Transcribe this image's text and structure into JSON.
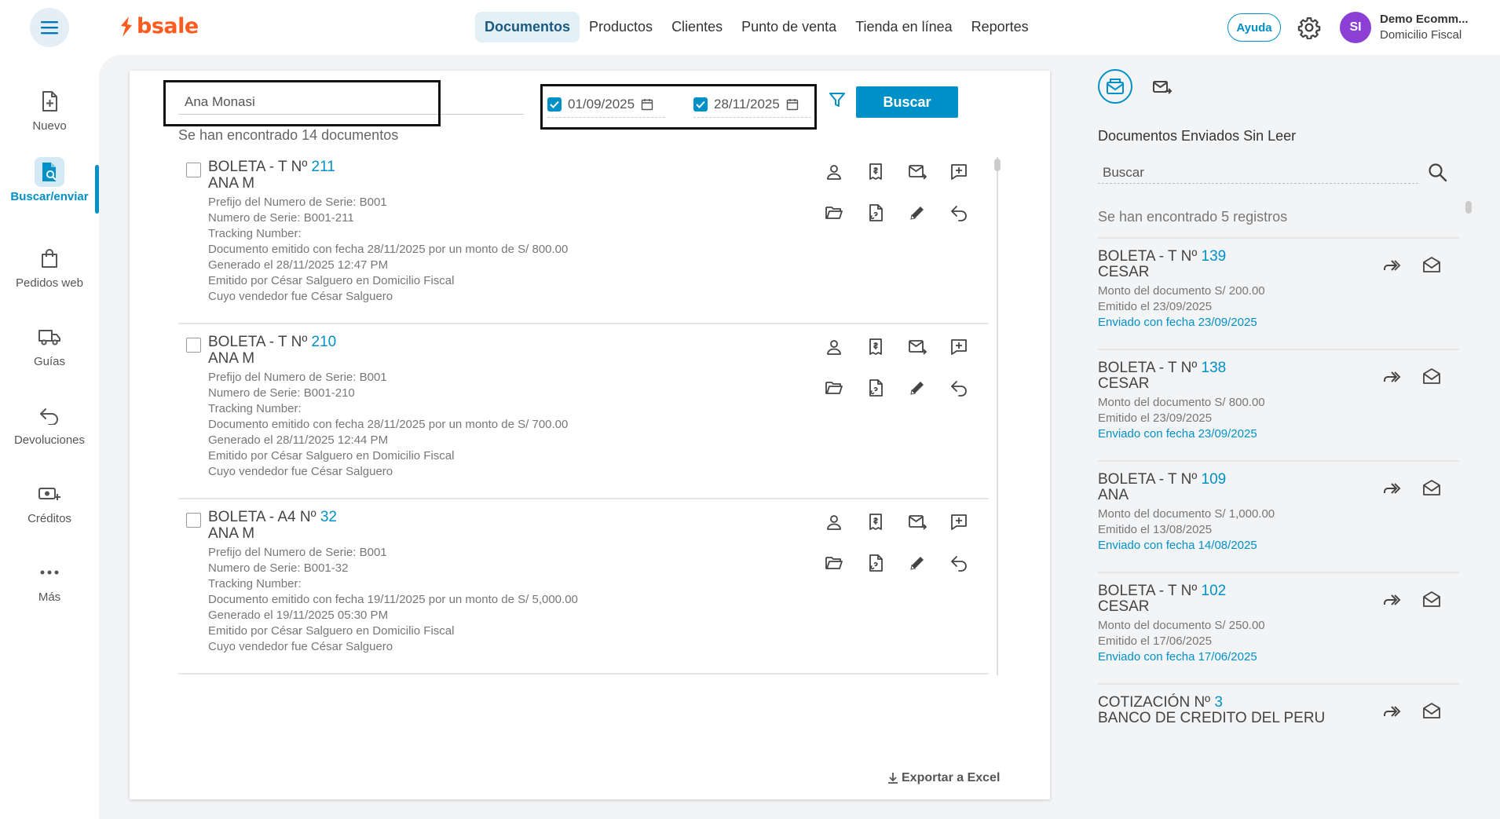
{
  "brand": {
    "logo_text": "bsale"
  },
  "nav": {
    "items": [
      "Documentos",
      "Productos",
      "Clientes",
      "Punto de venta",
      "Tienda en línea",
      "Reportes"
    ],
    "active": "Documentos"
  },
  "header": {
    "help_label": "Ayuda",
    "avatar_initials": "SI",
    "company_name": "Demo Ecomm...",
    "company_sub": "Domicilio Fiscal"
  },
  "sidebar": {
    "items": [
      {
        "label": "Nuevo",
        "icon": "file-add-icon"
      },
      {
        "label": "Buscar/enviar",
        "icon": "file-search-icon"
      },
      {
        "label": "Pedidos web",
        "icon": "shopping-bag-icon"
      },
      {
        "label": "Guías",
        "icon": "truck-icon"
      },
      {
        "label": "Devoluciones",
        "icon": "return-arrow-icon"
      },
      {
        "label": "Créditos",
        "icon": "credit-money-icon"
      },
      {
        "label": "Más",
        "icon": "more-dots-icon"
      }
    ],
    "active": "Buscar/enviar"
  },
  "search": {
    "query": "Ana Monasi",
    "date_from": "01/09/2025",
    "date_to": "28/11/2025",
    "button_label": "Buscar",
    "found_text": "Se han encontrado 14 documentos"
  },
  "documents": [
    {
      "title": "BOLETA - T Nº",
      "number": "211",
      "client": "ANA M",
      "lines": [
        "Prefijo del Numero de Serie: B001",
        "Numero de Serie: B001-211",
        "Tracking Number:",
        "Documento emitido con fecha 28/11/2025 por un monto de S/ 800.00",
        "Generado el 28/11/2025 12:47 PM",
        "Emitido por César Salguero en Domicilio Fiscal",
        "Cuyo vendedor fue César Salguero"
      ]
    },
    {
      "title": "BOLETA - T Nº",
      "number": "210",
      "client": "ANA M",
      "lines": [
        "Prefijo del Numero de Serie: B001",
        "Numero de Serie: B001-210",
        "Tracking Number:",
        "Documento emitido con fecha 28/11/2025 por un monto de S/ 700.00",
        "Generado el 28/11/2025 12:44 PM",
        "Emitido por César Salguero en Domicilio Fiscal",
        "Cuyo vendedor fue César Salguero"
      ]
    },
    {
      "title": "BOLETA - A4 Nº",
      "number": "32",
      "client": "ANA M",
      "lines": [
        "Prefijo del Numero de Serie: B001",
        "Numero de Serie: B001-32",
        "Tracking Number:",
        "Documento emitido con fecha 19/11/2025 por un monto de S/ 5,000.00",
        "Generado el 19/11/2025 05:30 PM",
        "Emitido por César Salguero en Domicilio Fiscal",
        "Cuyo vendedor fue César Salguero"
      ]
    }
  ],
  "doc_action_icons": [
    "user-icon",
    "receipt-icon",
    "mail-send-icon",
    "add-comment-icon",
    "folder-open-icon",
    "file-link-icon",
    "pencil-icon",
    "undo-icon"
  ],
  "export_label": "Exportar a Excel",
  "right_panel": {
    "title": "Documentos Enviados Sin Leer",
    "search_placeholder": "Buscar",
    "found_text": "Se han encontrado 5 registros",
    "items": [
      {
        "title": "BOLETA - T Nº",
        "number": "139",
        "client": "CESAR",
        "amount": "Monto del documento S/ 200.00",
        "emitted": "Emitido el 23/09/2025",
        "sent": "Enviado con fecha 23/09/2025"
      },
      {
        "title": "BOLETA - T Nº",
        "number": "138",
        "client": "CESAR",
        "amount": "Monto del documento S/ 800.00",
        "emitted": "Emitido el 23/09/2025",
        "sent": "Enviado con fecha 23/09/2025"
      },
      {
        "title": "BOLETA - T Nº",
        "number": "109",
        "client": "ANA",
        "amount": "Monto del documento S/ 1,000.00",
        "emitted": "Emitido el 13/08/2025",
        "sent": "Enviado con fecha 14/08/2025"
      },
      {
        "title": "BOLETA - T Nº",
        "number": "102",
        "client": "CESAR",
        "amount": "Monto del documento S/ 250.00",
        "emitted": "Emitido el 17/06/2025",
        "sent": "Enviado con fecha 17/06/2025"
      },
      {
        "title": "COTIZACIÓN Nº",
        "number": "3",
        "client": "BANCO DE CREDITO DEL PERU",
        "amount": "",
        "emitted": "",
        "sent": ""
      }
    ]
  },
  "colors": {
    "accent": "#0090c8",
    "brand_orange": "#ff5a1f",
    "avatar": "#8b3fd4"
  }
}
